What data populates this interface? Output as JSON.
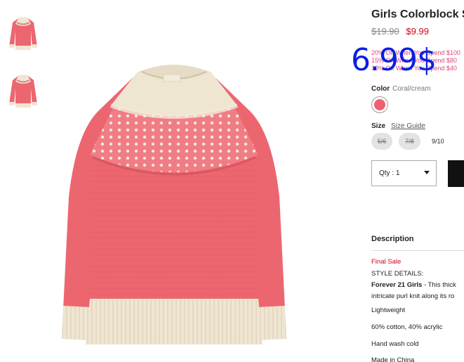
{
  "product": {
    "title": "Girls Colorblock S",
    "price_original": "$19.90",
    "price_sale": "$9.99",
    "overlay_price": "6.99$"
  },
  "promo": {
    "line1": "20% Off When You Spend $100",
    "line2": "15% Off When You Spend $80",
    "line3": "10% Off When You Spend $40"
  },
  "color": {
    "label": "Color",
    "value": "Coral/cream",
    "swatch_color": "#f06070"
  },
  "size": {
    "label": "Size",
    "guide_link": "Size Guide",
    "options": [
      {
        "label": "5/6",
        "available": false
      },
      {
        "label": "7/8",
        "available": false
      },
      {
        "label": "9/10",
        "available": true
      }
    ]
  },
  "quantity": {
    "label": "Qty : 1"
  },
  "description": {
    "heading": "Description",
    "final_sale": "Final Sale",
    "style_details": "STYLE DETAILS:",
    "brand": "Forever 21 Girls",
    "line1_rest": " - This thick",
    "line2": "intricate purl knit along its ro",
    "lightweight": "Lightweight",
    "content": "60% cotton, 40% acrylic",
    "care": "Hand wash cold",
    "origin": "Made in China"
  },
  "colors": {
    "price_sale": "#d0021b",
    "promo": "#e0457b",
    "overlay": "#0b1fe0"
  }
}
